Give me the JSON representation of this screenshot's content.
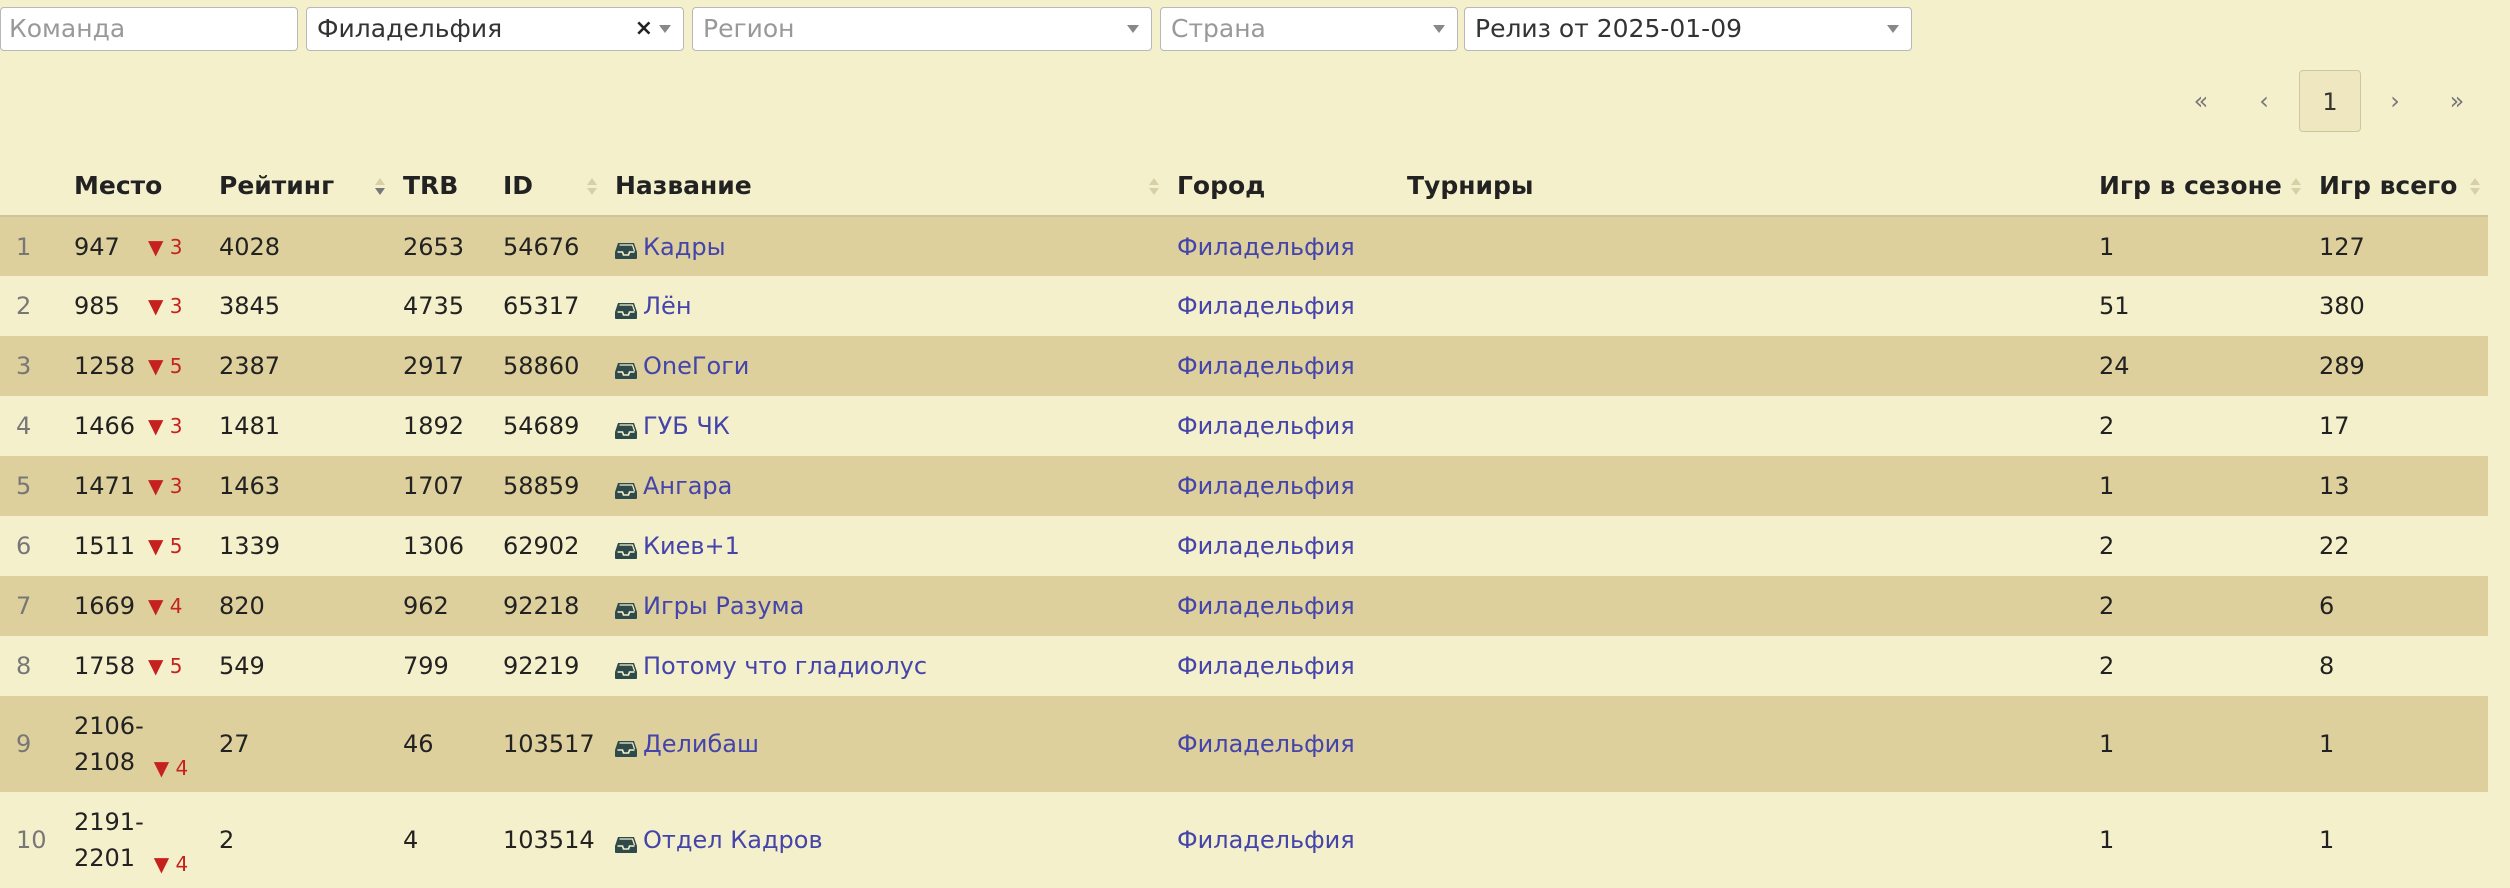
{
  "filters": {
    "team_placeholder": "Команда",
    "city_value": "Филадельфия",
    "region_placeholder": "Регион",
    "country_placeholder": "Страна",
    "release_value": "Релиз от 2025-01-09"
  },
  "pager": {
    "first": "«",
    "prev": "‹",
    "current": "1",
    "next": "›",
    "last": "»"
  },
  "table": {
    "headers": {
      "place": "Место",
      "rating": "Рейтинг",
      "trb": "TRB",
      "id": "ID",
      "name": "Название",
      "city": "Город",
      "tournaments": "Турниры",
      "season_games": "Игр в сезоне",
      "total_games": "Игр всего"
    },
    "rows": [
      {
        "n": "1",
        "place": "947",
        "delta": "▼ 3",
        "rating": "4028",
        "trb": "2653",
        "id": "54676",
        "name": "Кадры",
        "city": "Филадельфия",
        "season": "1",
        "total": "127"
      },
      {
        "n": "2",
        "place": "985",
        "delta": "▼ 3",
        "rating": "3845",
        "trb": "4735",
        "id": "65317",
        "name": "Лён",
        "city": "Филадельфия",
        "season": "51",
        "total": "380"
      },
      {
        "n": "3",
        "place": "1258",
        "delta": "▼ 5",
        "rating": "2387",
        "trb": "2917",
        "id": "58860",
        "name": "OneГоги",
        "city": "Филадельфия",
        "season": "24",
        "total": "289"
      },
      {
        "n": "4",
        "place": "1466",
        "delta": "▼ 3",
        "rating": "1481",
        "trb": "1892",
        "id": "54689",
        "name": "ГУБ ЧК",
        "city": "Филадельфия",
        "season": "2",
        "total": "17"
      },
      {
        "n": "5",
        "place": "1471",
        "delta": "▼ 3",
        "rating": "1463",
        "trb": "1707",
        "id": "58859",
        "name": "Ангара",
        "city": "Филадельфия",
        "season": "1",
        "total": "13"
      },
      {
        "n": "6",
        "place": "1511",
        "delta": "▼ 5",
        "rating": "1339",
        "trb": "1306",
        "id": "62902",
        "name": "Киев+1",
        "city": "Филадельфия",
        "season": "2",
        "total": "22"
      },
      {
        "n": "7",
        "place": "1669",
        "delta": "▼ 4",
        "rating": "820",
        "trb": "962",
        "id": "92218",
        "name": "Игры Разума",
        "city": "Филадельфия",
        "season": "2",
        "total": "6"
      },
      {
        "n": "8",
        "place": "1758",
        "delta": "▼ 5",
        "rating": "549",
        "trb": "799",
        "id": "92219",
        "name": "Потому что гладиолус",
        "city": "Филадельфия",
        "season": "2",
        "total": "8"
      },
      {
        "n": "9",
        "place1": "2106-",
        "place2": "2108",
        "delta": "▼ 4",
        "rating": "27",
        "trb": "46",
        "id": "103517",
        "name": "Делибаш",
        "city": "Филадельфия",
        "season": "1",
        "total": "1"
      },
      {
        "n": "10",
        "place1": "2191-",
        "place2": "2201",
        "delta": "▼ 4",
        "rating": "2",
        "trb": "4",
        "id": "103514",
        "name": "Отдел Кадров",
        "city": "Филадельфия",
        "season": "1",
        "total": "1"
      }
    ]
  }
}
